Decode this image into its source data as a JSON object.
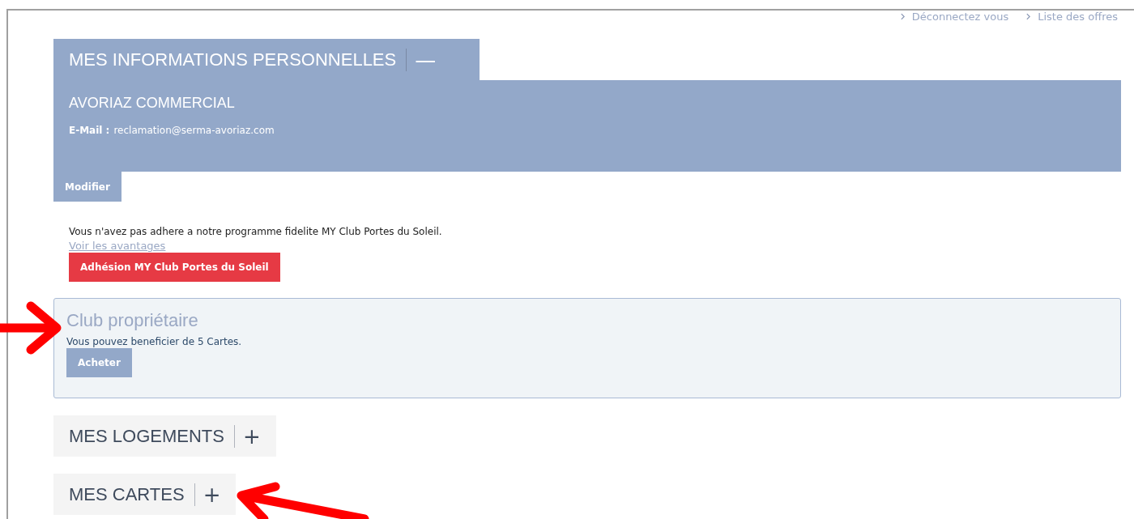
{
  "top_links": [
    {
      "label": "Déconnectez vous"
    },
    {
      "label": "Liste des offres"
    }
  ],
  "personal_info": {
    "title": "MES INFORMATIONS PERSONNELLES",
    "toggle": "—",
    "expanded": true,
    "name": "AVORIAZ COMMERCIAL",
    "email_label": "E-Mail :",
    "email": "reclamation@serma-avoriaz.com",
    "edit_button": "Modifier"
  },
  "loyalty": {
    "message": "Vous n'avez pas adhere a notre programme fidelite MY Club Portes du Soleil.",
    "link": "Voir les avantages",
    "button": "Adhésion MY Club Portes du Soleil"
  },
  "owner_club": {
    "title": "Club propriétaire",
    "message": "Vous pouvez beneficier de 5 Cartes.",
    "button": "Acheter"
  },
  "sections": [
    {
      "title": "MES LOGEMENTS",
      "toggle": "+",
      "expanded": false
    },
    {
      "title": "MES CARTES",
      "toggle": "+",
      "expanded": false
    }
  ]
}
